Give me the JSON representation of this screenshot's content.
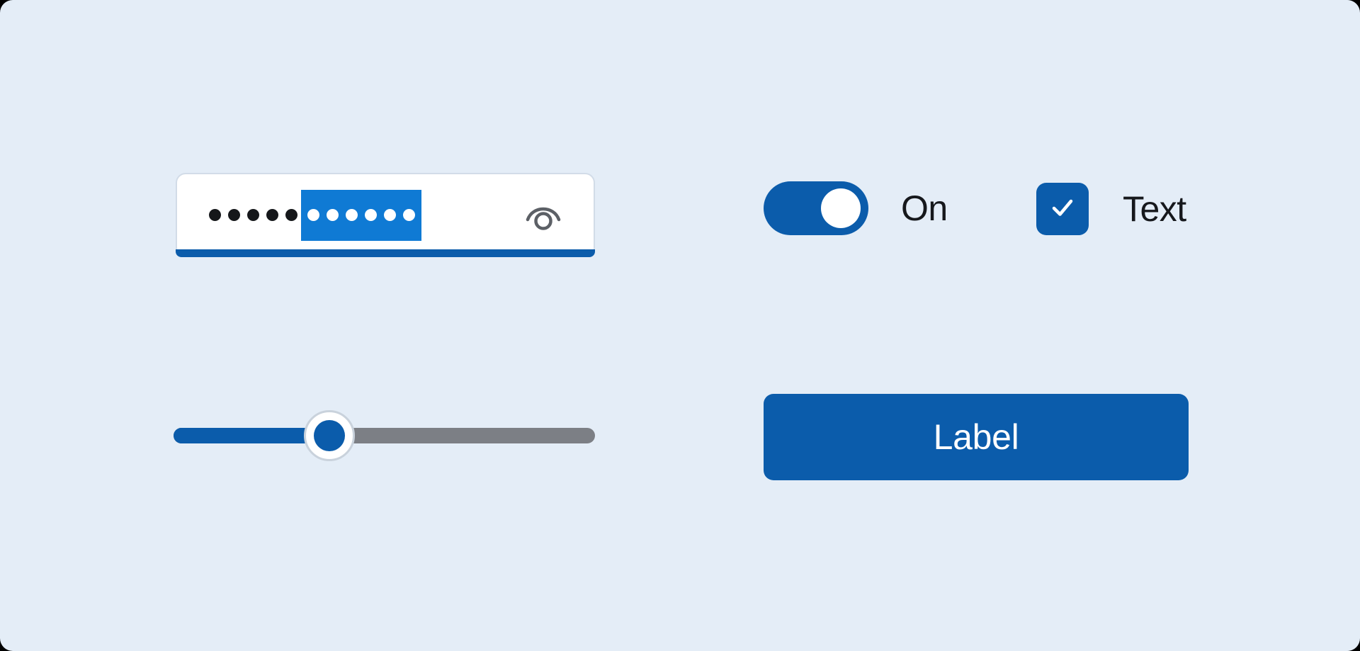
{
  "page": {
    "background_color": "#e4edf7",
    "accent_color": "#0b5cab",
    "selection_color": "#0f7ad4",
    "text_color": "#16181c"
  },
  "password_field": {
    "name": "password-input",
    "value_masked": "•••••••••••",
    "masked_dot_count": 5,
    "selected_dot_count": 6,
    "selection_highlight_color": "#0f7ad4",
    "focused": true,
    "focus_underline_color": "#0b5cab",
    "background_color": "#ffffff",
    "border_color": "#d2dce8",
    "reveal_icon": "eye-icon",
    "reveal_icon_color": "#5c6066"
  },
  "toggle": {
    "name": "toggle-switch",
    "label": "On",
    "state": "on",
    "checked": true,
    "track_color": "#0b5cab",
    "thumb_color": "#ffffff"
  },
  "checkbox": {
    "name": "checkbox",
    "label": "Text",
    "checked": true,
    "box_color": "#0b5cab",
    "check_icon": "check-icon",
    "check_color": "#ffffff"
  },
  "slider": {
    "name": "slider",
    "value_percent": 37,
    "min": 0,
    "max": 100,
    "active_track_color": "#0b5cab",
    "inactive_track_color": "#7c7f85",
    "thumb_fill_color": "#0b5cab",
    "thumb_ring_color": "#ffffff"
  },
  "button": {
    "name": "primary-button",
    "label": "Label",
    "background_color": "#0b5cab",
    "text_color": "#ffffff"
  }
}
